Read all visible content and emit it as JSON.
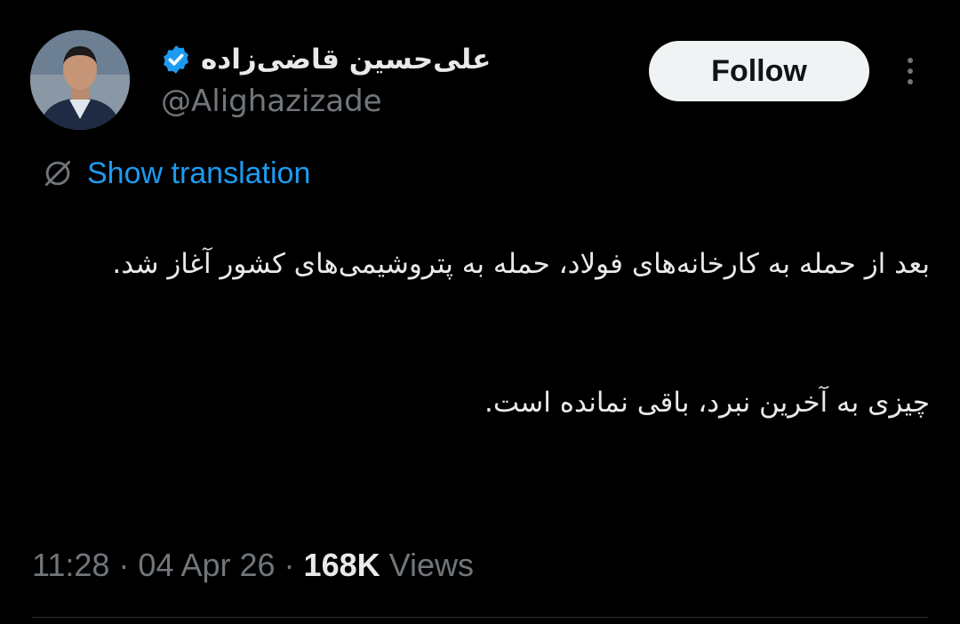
{
  "author": {
    "display_name": "علی‌حسین قاضی‌زاده",
    "handle": "@Alighazizade",
    "verified": true,
    "verified_color": "#1d9bf0"
  },
  "actions": {
    "follow_label": "Follow",
    "more_icon": "more-dots-vertical-icon"
  },
  "translation": {
    "label": "Show translation",
    "icon": "globe-slash-icon"
  },
  "tweet": {
    "paragraphs": [
      "بعد از حمله به کارخانه‌های فولاد، حمله به پتروشیمی‌های کشور آغاز شد.",
      "چیزی به آخرین نبرد، باقی نمانده است."
    ]
  },
  "meta": {
    "time": "11:28",
    "separator": "·",
    "date": "04 Apr 26",
    "views_count": "168K",
    "views_label": "Views"
  },
  "colors": {
    "background": "#000000",
    "text_primary": "#e7e9ea",
    "text_secondary": "#71767b",
    "accent": "#1d9bf0",
    "follow_bg": "#eff3f4"
  }
}
